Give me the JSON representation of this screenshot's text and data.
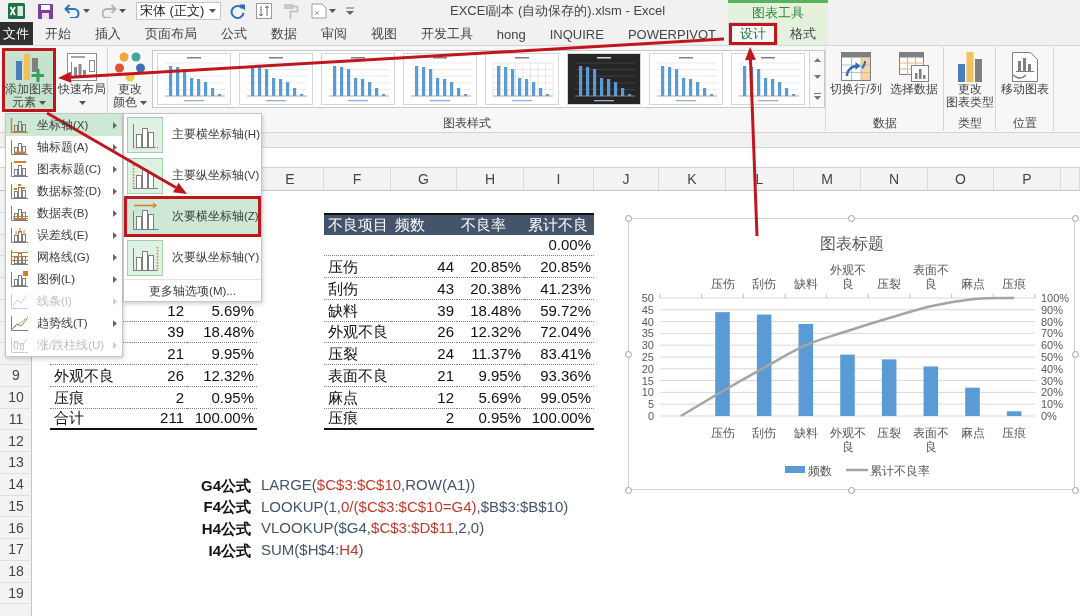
{
  "title_bar": {
    "font_box": "宋体 (正文)",
    "title": "EXCEl副本 (自动保存的).xlsm - Excel",
    "context_group": "图表工具"
  },
  "tabs": [
    {
      "label": "文件",
      "kind": "file",
      "selected": false,
      "callout": false
    },
    {
      "label": "开始",
      "kind": "normal",
      "selected": false,
      "callout": false
    },
    {
      "label": "插入",
      "kind": "normal",
      "selected": false,
      "callout": false
    },
    {
      "label": "页面布局",
      "kind": "normal",
      "selected": false,
      "callout": false
    },
    {
      "label": "公式",
      "kind": "normal",
      "selected": false,
      "callout": false
    },
    {
      "label": "数据",
      "kind": "normal",
      "selected": false,
      "callout": false
    },
    {
      "label": "审阅",
      "kind": "normal",
      "selected": false,
      "callout": false
    },
    {
      "label": "视图",
      "kind": "normal",
      "selected": false,
      "callout": false
    },
    {
      "label": "开发工具",
      "kind": "normal",
      "selected": false,
      "callout": false
    },
    {
      "label": "hong",
      "kind": "normal",
      "selected": false,
      "callout": false
    },
    {
      "label": "INQUIRE",
      "kind": "normal",
      "selected": false,
      "callout": false
    },
    {
      "label": "POWERPIVOT",
      "kind": "normal",
      "selected": false,
      "callout": false
    },
    {
      "label": "设计",
      "kind": "context",
      "selected": true,
      "callout": true
    },
    {
      "label": "格式",
      "kind": "context",
      "selected": false,
      "callout": false
    }
  ],
  "ribbon": {
    "groups": [
      {
        "buttons": [
          {
            "lines": [
              "添加图表",
              "元素"
            ],
            "dropdown": true,
            "selected": true,
            "callout": true
          },
          {
            "lines": [
              "快速布局"
            ],
            "dropdown": true,
            "selected": false,
            "callout": false
          }
        ]
      },
      {
        "label": "图表样式",
        "buttons": [
          {
            "lines": [
              "更改",
              "颜色"
            ],
            "dropdown": true,
            "selected": false,
            "callout": false
          }
        ],
        "gallery": [
          {
            "kind": "light"
          },
          {
            "kind": "light"
          },
          {
            "kind": "light"
          },
          {
            "kind": "light"
          },
          {
            "kind": "grid"
          },
          {
            "kind": "dark"
          },
          {
            "kind": "light"
          },
          {
            "kind": "light"
          }
        ]
      },
      {
        "label": "数据",
        "buttons": [
          {
            "lines": [
              "切换行/列"
            ],
            "dropdown": false,
            "selected": false,
            "callout": false
          },
          {
            "lines": [
              "选择数据"
            ],
            "dropdown": false,
            "selected": false,
            "callout": false
          }
        ]
      },
      {
        "label": "类型",
        "buttons": [
          {
            "lines": [
              "更改",
              "图表类型"
            ],
            "dropdown": false,
            "selected": false,
            "callout": false
          }
        ]
      },
      {
        "label": "位置",
        "buttons": [
          {
            "lines": [
              "移动图表"
            ],
            "dropdown": false,
            "selected": false,
            "callout": false
          }
        ]
      }
    ]
  },
  "sheet": {
    "column_headers": [
      "E",
      "F",
      "G",
      "H",
      "I",
      "J",
      "K",
      "L",
      "M",
      "N",
      "O",
      "P"
    ],
    "row_headers": [
      "9",
      "10",
      "11",
      "12",
      "13",
      "14",
      "15",
      "16",
      "17",
      "18",
      "19"
    ],
    "left_table": {
      "rows": [
        {
          "count": "12",
          "rate": "5.69%"
        },
        {
          "count": "39",
          "rate": "18.48%"
        },
        {
          "count": "21",
          "rate": "9.95%"
        },
        {
          "label": "外观不良",
          "count": "26",
          "rate": "12.32%"
        },
        {
          "label": "压痕",
          "count": "2",
          "rate": "0.95%"
        },
        {
          "label": "合计",
          "count": "211",
          "rate": "100.00%"
        }
      ]
    },
    "right_table": {
      "header": [
        "不良项目",
        "频数",
        "不良率",
        "累计不良"
      ],
      "rows": [
        {
          "cumulative": "0.00%"
        },
        {
          "label": "压伤",
          "count": "44",
          "rate": "20.85%",
          "cumulative": "20.85%"
        },
        {
          "label": "刮伤",
          "count": "43",
          "rate": "20.38%",
          "cumulative": "41.23%"
        },
        {
          "label": "缺料",
          "count": "39",
          "rate": "18.48%",
          "cumulative": "59.72%"
        },
        {
          "label": "外观不良",
          "count": "26",
          "rate": "12.32%",
          "cumulative": "72.04%"
        },
        {
          "label": "压裂",
          "count": "24",
          "rate": "11.37%",
          "cumulative": "83.41%"
        },
        {
          "label": "表面不良",
          "count": "21",
          "rate": "9.95%",
          "cumulative": "93.36%"
        },
        {
          "label": "麻点",
          "count": "12",
          "rate": "5.69%",
          "cumulative": "99.05%"
        },
        {
          "label": "压痕",
          "count": "2",
          "rate": "0.95%",
          "cumulative": "100.00%"
        }
      ]
    },
    "formulas": [
      {
        "label": "G4公式",
        "parts": [
          {
            "text": "LARGE(",
            "highlight": false
          },
          {
            "text": "$C$3:$C$10",
            "highlight": true
          },
          {
            "text": ",ROW(A1))",
            "highlight": false
          }
        ]
      },
      {
        "label": "F4公式",
        "parts": [
          {
            "text": "LOOKUP(1,",
            "highlight": false
          },
          {
            "text": "0/($C$3:$C$10=G4)",
            "highlight": true
          },
          {
            "text": ",$B$3:$B$10)",
            "highlight": false
          }
        ]
      },
      {
        "label": "H4公式",
        "parts": [
          {
            "text": "VLOOKUP($G4,",
            "highlight": false
          },
          {
            "text": "$C$3:$D$11",
            "highlight": true
          },
          {
            "text": ",2,0)",
            "highlight": false
          }
        ]
      },
      {
        "label": "I4公式",
        "parts": [
          {
            "text": "SUM($H$4:",
            "highlight": false
          },
          {
            "text": "H4",
            "highlight": true
          },
          {
            "text": ")",
            "highlight": false
          }
        ]
      }
    ]
  },
  "chart": {
    "top_axis_labels": [
      "压伤",
      "刮伤",
      "缺料",
      "外观不良",
      "压裂",
      "表面不良",
      "麻点",
      "压痕"
    ],
    "chart_data": {
      "type": "bar",
      "title": "图表标题",
      "categories": [
        null,
        "压伤",
        "刮伤",
        "缺料",
        "外观不良",
        "压裂",
        "表面不良",
        "麻点",
        "压痕"
      ],
      "series": [
        {
          "name": "频数",
          "color": "#5b9bd5",
          "values": [
            null,
            44,
            43,
            39,
            26,
            24,
            21,
            12,
            2
          ]
        },
        {
          "name": "累计不良率",
          "type": "line",
          "axis": "y2",
          "color": "#a5a5a5",
          "values": [
            0,
            21,
            41,
            60,
            72,
            83,
            93,
            99,
            100
          ]
        }
      ],
      "ylim": [
        0,
        50
      ],
      "yticks": [
        {
          "value": 0,
          "label": "0"
        },
        {
          "value": 5,
          "label": "5"
        },
        {
          "value": 10,
          "label": "10"
        },
        {
          "value": 15,
          "label": "15"
        },
        {
          "value": 20,
          "label": "20"
        },
        {
          "value": 25,
          "label": "25"
        },
        {
          "value": 30,
          "label": "30"
        },
        {
          "value": 35,
          "label": "35"
        },
        {
          "value": 40,
          "label": "40"
        },
        {
          "value": 45,
          "label": "45"
        },
        {
          "value": 50,
          "label": "50"
        }
      ],
      "y2lim": [
        0,
        100
      ],
      "y2ticks": [
        {
          "value": 0,
          "label": "0%"
        },
        {
          "value": 10,
          "label": "10%"
        },
        {
          "value": 20,
          "label": "20%"
        },
        {
          "value": 30,
          "label": "30%"
        },
        {
          "value": 40,
          "label": "40%"
        },
        {
          "value": 50,
          "label": "50%"
        },
        {
          "value": 60,
          "label": "60%"
        },
        {
          "value": 70,
          "label": "70%"
        },
        {
          "value": 80,
          "label": "80%"
        },
        {
          "value": 90,
          "label": "90%"
        },
        {
          "value": 100,
          "label": "100%"
        }
      ],
      "grid": true,
      "legend": "bottom"
    }
  },
  "chart_element_menu": {
    "items": [
      {
        "label": "坐标轴(X)",
        "selected": true,
        "disabled": false
      },
      {
        "label": "轴标题(A)",
        "selected": false,
        "disabled": false
      },
      {
        "label": "图表标题(C)",
        "selected": false,
        "disabled": false
      },
      {
        "label": "数据标签(D)",
        "selected": false,
        "disabled": false
      },
      {
        "label": "数据表(B)",
        "selected": false,
        "disabled": false
      },
      {
        "label": "误差线(E)",
        "selected": false,
        "disabled": false
      },
      {
        "label": "网格线(G)",
        "selected": false,
        "disabled": false
      },
      {
        "label": "图例(L)",
        "selected": false,
        "disabled": false
      },
      {
        "label": "线条(I)",
        "selected": false,
        "disabled": true
      },
      {
        "label": "趋势线(T)",
        "selected": false,
        "disabled": false
      },
      {
        "label": "涨/跌柱线(U)",
        "selected": false,
        "disabled": true
      }
    ]
  },
  "axis_submenu": {
    "items": [
      {
        "label": "主要横坐标轴(H)",
        "selected": false,
        "on": true,
        "callout": false
      },
      {
        "label": "主要纵坐标轴(V)",
        "selected": false,
        "on": true,
        "callout": false
      },
      {
        "label": "次要横坐标轴(Z)",
        "selected": true,
        "on": false,
        "callout": true
      },
      {
        "label": "次要纵坐标轴(Y)",
        "selected": false,
        "on": true,
        "callout": false
      }
    ],
    "more": "更多轴选项(M)..."
  },
  "annotations": [
    {
      "kind": "arrow"
    },
    {
      "kind": "arrow"
    },
    {
      "kind": "arrow"
    }
  ]
}
